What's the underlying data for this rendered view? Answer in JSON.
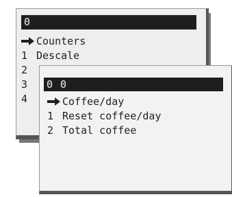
{
  "back_menu": {
    "header": "0",
    "selected_label": "Counters",
    "items": [
      {
        "num": "1",
        "label": "Descale"
      },
      {
        "num": "2",
        "label": ""
      },
      {
        "num": "3",
        "label": ""
      },
      {
        "num": "4",
        "label": ""
      }
    ]
  },
  "front_menu": {
    "header": "0 0",
    "selected_label": "Coffee/day",
    "items": [
      {
        "num": "1",
        "label": "Reset coffee/day"
      },
      {
        "num": "2",
        "label": "Total coffee"
      }
    ]
  },
  "icons": {
    "selection_marker": "right-arrow-icon"
  },
  "colors": {
    "header_bg": "#1e1e1e",
    "header_text": "#f0f0f0",
    "screen_bg": "#eeeeec",
    "frame": "#555555"
  }
}
